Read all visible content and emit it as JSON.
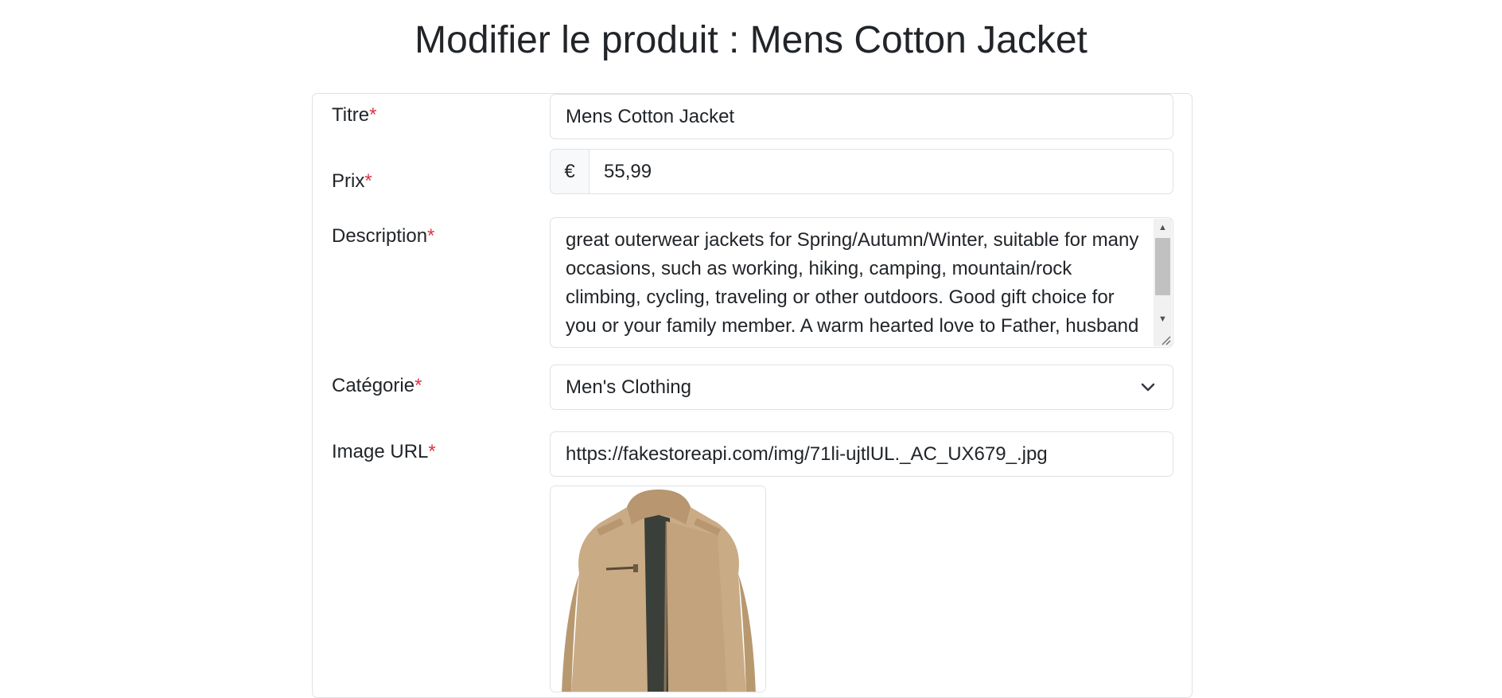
{
  "page": {
    "title": "Modifier le produit : Mens Cotton Jacket"
  },
  "form": {
    "required_mark": "*",
    "title_label": "Titre",
    "title_value": "Mens Cotton Jacket",
    "price_label": "Prix",
    "currency_symbol": "€",
    "price_value": "55,99",
    "description_label": "Description",
    "description_value": "great outerwear jackets for Spring/Autumn/Winter, suitable for many occasions, such as working, hiking, camping, mountain/rock climbing, cycling, traveling or other outdoors. Good gift choice for you or your family member. A warm hearted love to Father, husband",
    "category_label": "Catégorie",
    "category_value": "Men's Clothing",
    "image_url_label": "Image URL",
    "image_url_value": "https://fakestoreapi.com/img/71li-ujtlUL._AC_UX679_.jpg",
    "image_preview_icon": "jacket-image"
  },
  "colors": {
    "required": "#dc3545",
    "border": "#dee2e6",
    "addon_bg": "#f8f9fa",
    "jacket": "#c9ab85"
  }
}
